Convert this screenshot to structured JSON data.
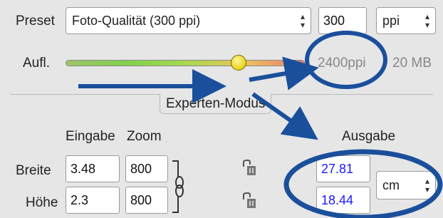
{
  "preset": {
    "label": "Preset",
    "value": "Foto-Qualität (300 ppi)",
    "ppi_value": "300",
    "unit": "ppi"
  },
  "resolution": {
    "label": "Aufl.",
    "slider_level_fraction": 0.6,
    "ppi_text": "2400ppi",
    "size_text": "20 MB"
  },
  "expert": {
    "title": "Experten-Modus",
    "header_input": "Eingabe",
    "header_zoom": "Zoom",
    "header_output": "Ausgabe",
    "width_label": "Breite",
    "height_label": "Höhe",
    "width_input": "3.48",
    "height_input": "2.3",
    "width_zoom": "800",
    "height_zoom": "800",
    "width_output": "27.81",
    "height_output": "18.44",
    "unit": "cm"
  },
  "icons": {
    "chain": "chain-link-icon",
    "lock": "lock-icon",
    "select_arrows": "up-down-arrows-icon"
  },
  "colors": {
    "annotation": "#1a4f9c",
    "output_value": "#1a1aff",
    "background": "#e6e6e6"
  }
}
